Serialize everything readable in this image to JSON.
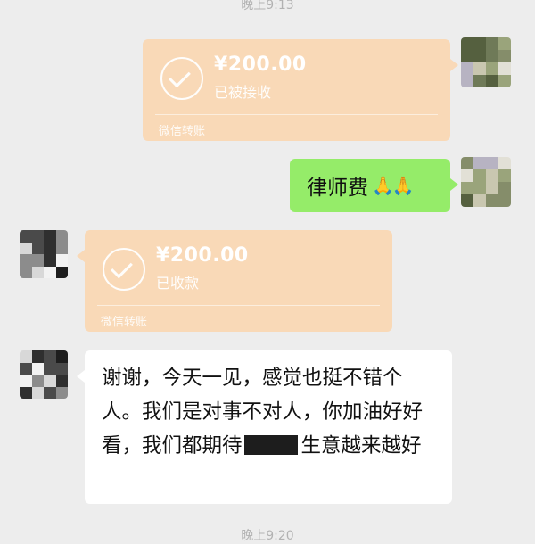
{
  "timestamps": {
    "top": "晚上9:13",
    "bottom": "晚上9:20"
  },
  "messages": {
    "sent_transfer": {
      "amount": "¥200.00",
      "status": "已被接收",
      "source": "微信转账",
      "icon": "check-circle-icon"
    },
    "sent_text": {
      "text": "律师费",
      "emoji": "🙏🙏"
    },
    "received_transfer": {
      "amount": "¥200.00",
      "status": "已收款",
      "source": "微信转账",
      "icon": "check-circle-icon"
    },
    "received_text": {
      "part1": "谢谢，今天一见，感觉也挺不错个人。我们是对事不对人，你加油好好看，我们都期待",
      "part2": "生意越来越好"
    }
  },
  "colors": {
    "background": "#ededed",
    "transfer_bubble": "#f9d9b7",
    "sent_bubble": "#95ec69",
    "received_bubble": "#ffffff"
  }
}
